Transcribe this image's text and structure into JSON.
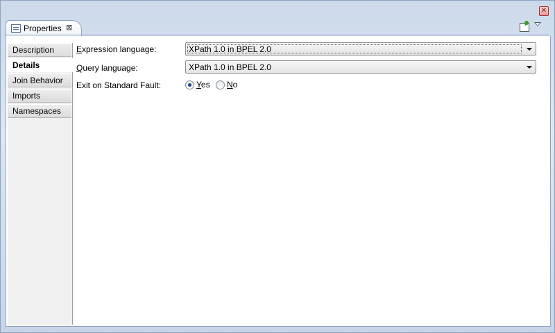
{
  "view": {
    "title": "Properties",
    "close_glyph": "⊠",
    "window_close_glyph": "✕",
    "icons": [
      "table-icon",
      "pin-icon",
      "view-menu-icon"
    ]
  },
  "sidebar": {
    "tabs": [
      {
        "label": "Description",
        "selected": false
      },
      {
        "label": "Details",
        "selected": true
      },
      {
        "label": "Join Behavior",
        "selected": false
      },
      {
        "label": "Imports",
        "selected": false
      },
      {
        "label": "Namespaces",
        "selected": false
      }
    ]
  },
  "form": {
    "expression_language": {
      "label_mnemonic": "E",
      "label_rest": "xpression language:",
      "value": "XPath 1.0 in BPEL 2.0"
    },
    "query_language": {
      "label_mnemonic": "Q",
      "label_rest": "uery language:",
      "value": "XPath 1.0 in BPEL 2.0"
    },
    "exit_on_standard_fault": {
      "label": "Exit on Standard Fault:",
      "options": [
        {
          "mnemonic": "Y",
          "rest": "es",
          "checked": true
        },
        {
          "mnemonic": "N",
          "rest": "o",
          "checked": false
        }
      ]
    }
  },
  "colors": {
    "frame_border": "#8ea3c0",
    "frame_bg": "#ccd9ea",
    "close_red": "#e49c9c",
    "radio_dot": "#1d3f8a"
  }
}
